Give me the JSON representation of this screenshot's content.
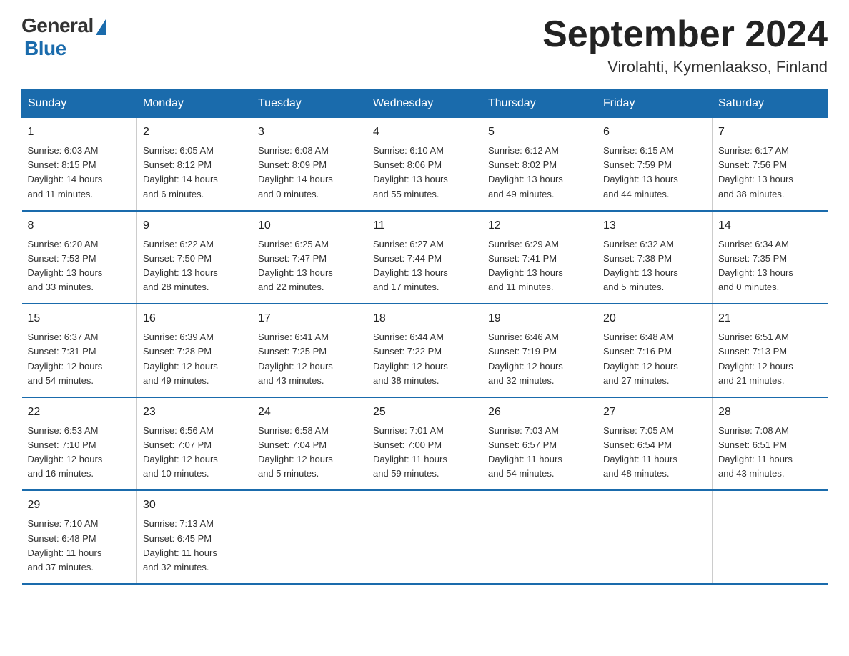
{
  "header": {
    "logo_general": "General",
    "logo_blue": "Blue",
    "title": "September 2024",
    "subtitle": "Virolahti, Kymenlaakso, Finland"
  },
  "days_of_week": [
    "Sunday",
    "Monday",
    "Tuesday",
    "Wednesday",
    "Thursday",
    "Friday",
    "Saturday"
  ],
  "weeks": [
    [
      {
        "day": "1",
        "sunrise": "6:03 AM",
        "sunset": "8:15 PM",
        "daylight": "14 hours and 11 minutes."
      },
      {
        "day": "2",
        "sunrise": "6:05 AM",
        "sunset": "8:12 PM",
        "daylight": "14 hours and 6 minutes."
      },
      {
        "day": "3",
        "sunrise": "6:08 AM",
        "sunset": "8:09 PM",
        "daylight": "14 hours and 0 minutes."
      },
      {
        "day": "4",
        "sunrise": "6:10 AM",
        "sunset": "8:06 PM",
        "daylight": "13 hours and 55 minutes."
      },
      {
        "day": "5",
        "sunrise": "6:12 AM",
        "sunset": "8:02 PM",
        "daylight": "13 hours and 49 minutes."
      },
      {
        "day": "6",
        "sunrise": "6:15 AM",
        "sunset": "7:59 PM",
        "daylight": "13 hours and 44 minutes."
      },
      {
        "day": "7",
        "sunrise": "6:17 AM",
        "sunset": "7:56 PM",
        "daylight": "13 hours and 38 minutes."
      }
    ],
    [
      {
        "day": "8",
        "sunrise": "6:20 AM",
        "sunset": "7:53 PM",
        "daylight": "13 hours and 33 minutes."
      },
      {
        "day": "9",
        "sunrise": "6:22 AM",
        "sunset": "7:50 PM",
        "daylight": "13 hours and 28 minutes."
      },
      {
        "day": "10",
        "sunrise": "6:25 AM",
        "sunset": "7:47 PM",
        "daylight": "13 hours and 22 minutes."
      },
      {
        "day": "11",
        "sunrise": "6:27 AM",
        "sunset": "7:44 PM",
        "daylight": "13 hours and 17 minutes."
      },
      {
        "day": "12",
        "sunrise": "6:29 AM",
        "sunset": "7:41 PM",
        "daylight": "13 hours and 11 minutes."
      },
      {
        "day": "13",
        "sunrise": "6:32 AM",
        "sunset": "7:38 PM",
        "daylight": "13 hours and 5 minutes."
      },
      {
        "day": "14",
        "sunrise": "6:34 AM",
        "sunset": "7:35 PM",
        "daylight": "13 hours and 0 minutes."
      }
    ],
    [
      {
        "day": "15",
        "sunrise": "6:37 AM",
        "sunset": "7:31 PM",
        "daylight": "12 hours and 54 minutes."
      },
      {
        "day": "16",
        "sunrise": "6:39 AM",
        "sunset": "7:28 PM",
        "daylight": "12 hours and 49 minutes."
      },
      {
        "day": "17",
        "sunrise": "6:41 AM",
        "sunset": "7:25 PM",
        "daylight": "12 hours and 43 minutes."
      },
      {
        "day": "18",
        "sunrise": "6:44 AM",
        "sunset": "7:22 PM",
        "daylight": "12 hours and 38 minutes."
      },
      {
        "day": "19",
        "sunrise": "6:46 AM",
        "sunset": "7:19 PM",
        "daylight": "12 hours and 32 minutes."
      },
      {
        "day": "20",
        "sunrise": "6:48 AM",
        "sunset": "7:16 PM",
        "daylight": "12 hours and 27 minutes."
      },
      {
        "day": "21",
        "sunrise": "6:51 AM",
        "sunset": "7:13 PM",
        "daylight": "12 hours and 21 minutes."
      }
    ],
    [
      {
        "day": "22",
        "sunrise": "6:53 AM",
        "sunset": "7:10 PM",
        "daylight": "12 hours and 16 minutes."
      },
      {
        "day": "23",
        "sunrise": "6:56 AM",
        "sunset": "7:07 PM",
        "daylight": "12 hours and 10 minutes."
      },
      {
        "day": "24",
        "sunrise": "6:58 AM",
        "sunset": "7:04 PM",
        "daylight": "12 hours and 5 minutes."
      },
      {
        "day": "25",
        "sunrise": "7:01 AM",
        "sunset": "7:00 PM",
        "daylight": "11 hours and 59 minutes."
      },
      {
        "day": "26",
        "sunrise": "7:03 AM",
        "sunset": "6:57 PM",
        "daylight": "11 hours and 54 minutes."
      },
      {
        "day": "27",
        "sunrise": "7:05 AM",
        "sunset": "6:54 PM",
        "daylight": "11 hours and 48 minutes."
      },
      {
        "day": "28",
        "sunrise": "7:08 AM",
        "sunset": "6:51 PM",
        "daylight": "11 hours and 43 minutes."
      }
    ],
    [
      {
        "day": "29",
        "sunrise": "7:10 AM",
        "sunset": "6:48 PM",
        "daylight": "11 hours and 37 minutes."
      },
      {
        "day": "30",
        "sunrise": "7:13 AM",
        "sunset": "6:45 PM",
        "daylight": "11 hours and 32 minutes."
      },
      {
        "day": "",
        "sunrise": "",
        "sunset": "",
        "daylight": ""
      },
      {
        "day": "",
        "sunrise": "",
        "sunset": "",
        "daylight": ""
      },
      {
        "day": "",
        "sunrise": "",
        "sunset": "",
        "daylight": ""
      },
      {
        "day": "",
        "sunrise": "",
        "sunset": "",
        "daylight": ""
      },
      {
        "day": "",
        "sunrise": "",
        "sunset": "",
        "daylight": ""
      }
    ]
  ],
  "labels": {
    "sunrise": "Sunrise:",
    "sunset": "Sunset:",
    "daylight": "Daylight:"
  }
}
